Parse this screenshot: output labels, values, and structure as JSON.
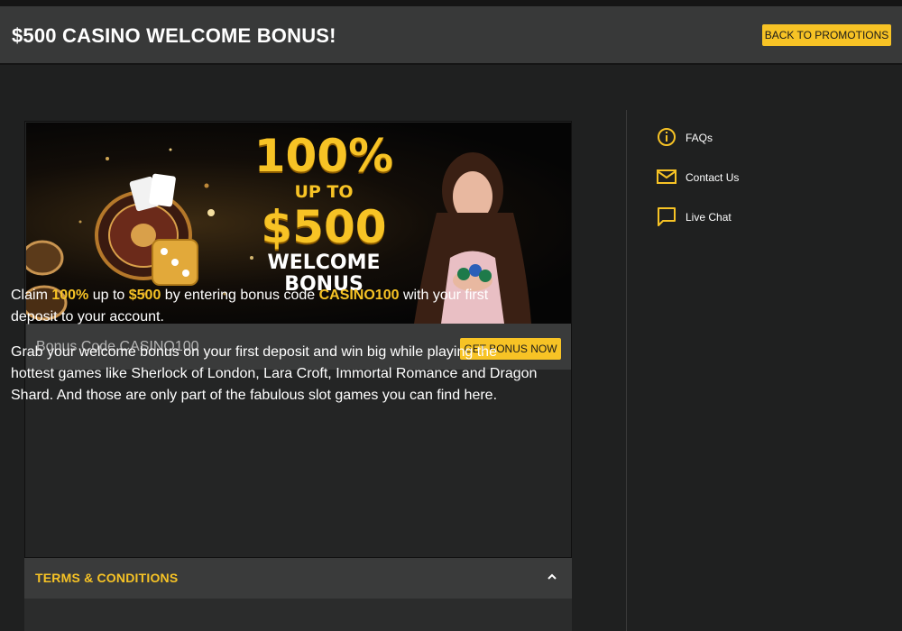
{
  "header": {
    "title": "$500 CASINO WELCOME BONUS!",
    "back_label": "BACK TO PROMOTIONS"
  },
  "banner": {
    "percent": "100%",
    "up_to": "UP TO",
    "amount": "$500",
    "welcome": "WELCOME",
    "bonus": "BONUS"
  },
  "bonus": {
    "code_text": "Bonus Code CASINO100",
    "get_label": "GET BONUS NOW"
  },
  "description": {
    "p1_a": "Claim ",
    "p1_percent": "100%",
    "p1_b": " up to ",
    "p1_amount": "$500",
    "p1_c": " by entering bonus code ",
    "p1_code": "CASINO100",
    "p1_d": " with your first deposit to your account.",
    "p2": "Grab your welcome bonus on your first deposit and win big while playing the hottest games like Sherlock of London, Lara Croft, Immortal Romance and Dragon Shard. And those are only part of the fabulous slot games you can find here."
  },
  "terms": {
    "label": "TERMS & CONDITIONS"
  },
  "sidebar": {
    "items": [
      {
        "label": "FAQs",
        "icon": "info-icon"
      },
      {
        "label": "Contact Us",
        "icon": "mail-icon"
      },
      {
        "label": "Live Chat",
        "icon": "chat-icon"
      }
    ]
  },
  "colors": {
    "accent": "#f7c325",
    "header_bg": "#383939",
    "page_bg": "#1f2020"
  }
}
